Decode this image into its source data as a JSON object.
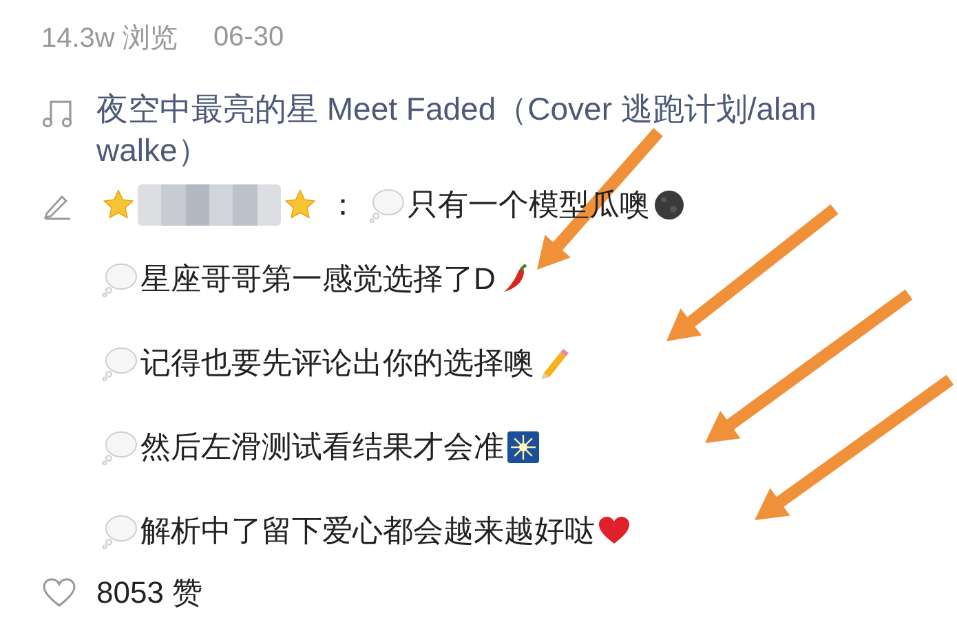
{
  "meta": {
    "views": "14.3w 浏览",
    "date": "06-30"
  },
  "song": {
    "title": "夜空中最亮的星 Meet Faded（Cover 逃跑计划/alan walke）"
  },
  "comment": {
    "separator": "：",
    "lines": [
      {
        "text": "只有一个模型瓜噢",
        "kind": "moon"
      },
      {
        "text": "星座哥哥第一感觉选择了D",
        "kind": "chili"
      },
      {
        "text": "记得也要先评论出你的选择噢",
        "kind": "pencil"
      },
      {
        "text": "然后左滑测试看结果才会准",
        "kind": "sparkler"
      },
      {
        "text": "解析中了留下爱心都会越来越好哒",
        "kind": "heart"
      }
    ]
  },
  "likes": {
    "count": "8053 赞"
  }
}
